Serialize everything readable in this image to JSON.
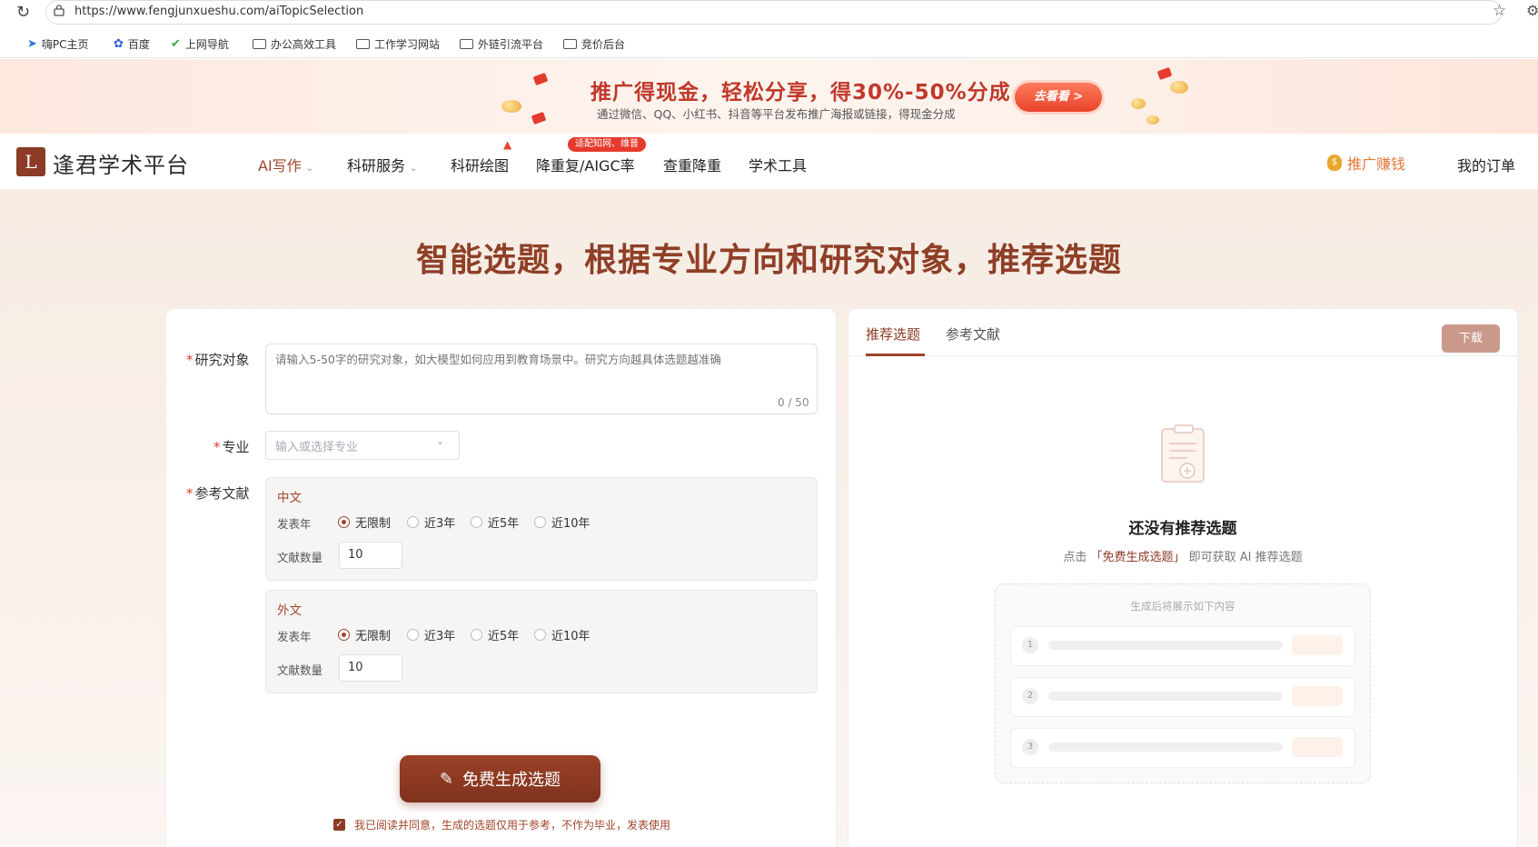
{
  "browser": {
    "url": "https://www.fengjunxueshu.com/aiTopicSelection",
    "bookmarks": [
      "嗨PC主页",
      "百度",
      "上网导航",
      "办公高效工具",
      "工作学习网站",
      "外链引流平台",
      "竞价后台"
    ]
  },
  "promo": {
    "title": "推广得现金，轻松分享，得30%-50%分成",
    "subtitle": "通过微信、QQ、小红书、抖音等平台发布推广海报或链接，得现金分成",
    "button": "去看看 >"
  },
  "nav": {
    "logo_mark": "L",
    "logo_text": "逢君学术平台",
    "items": [
      {
        "label": "AI写作",
        "caret": "⌄"
      },
      {
        "label": "科研服务",
        "caret": "⌄"
      },
      {
        "label": "科研绘图"
      },
      {
        "label": "降重复/AIGC率"
      },
      {
        "label": "查重降重"
      },
      {
        "label": "学术工具"
      }
    ],
    "badge": "适配知网、维普",
    "promote": "推广赚钱",
    "orders": "我的订单"
  },
  "hero": "智能选题，根据专业方向和研究对象，推荐选题",
  "form": {
    "research_label": "研究对象",
    "research_placeholder": "请输入5-50字的研究对象，如大模型如何应用到教育场景中。研究方向越具体选题越准确",
    "research_counter": "0 / 50",
    "major_label": "专业",
    "major_placeholder": "输入或选择专业",
    "ref_label": "参考文献",
    "chinese": {
      "title": "中文",
      "year_label": "发表年",
      "options": [
        "无限制",
        "近3年",
        "近5年",
        "近10年"
      ],
      "selected": "无限制",
      "count_label": "文献数量",
      "count": "10"
    },
    "foreign": {
      "title": "外文",
      "year_label": "发表年",
      "options": [
        "无限制",
        "近3年",
        "近5年",
        "近10年"
      ],
      "selected": "无限制",
      "count_label": "文献数量",
      "count": "10"
    },
    "submit": "免费生成选题",
    "agreement": "我已阅读并同意，生成的选题仅用于参考，不作为毕业，发表使用"
  },
  "result": {
    "tabs": [
      "推荐选题",
      "参考文献"
    ],
    "active_tab": "推荐选题",
    "download": "下载",
    "empty_title": "还没有推荐选题",
    "empty_sub_pre": "点击",
    "empty_sub_link": "「免费生成选题」",
    "empty_sub_post": "即可获取 AI 推荐选题",
    "preview_caption": "生成后将展示如下内容",
    "preview_rows": [
      "1",
      "2",
      "3"
    ]
  },
  "colors": {
    "brand": "#8b3b26",
    "accent": "#a0452a",
    "promo_red": "#c0392b"
  }
}
